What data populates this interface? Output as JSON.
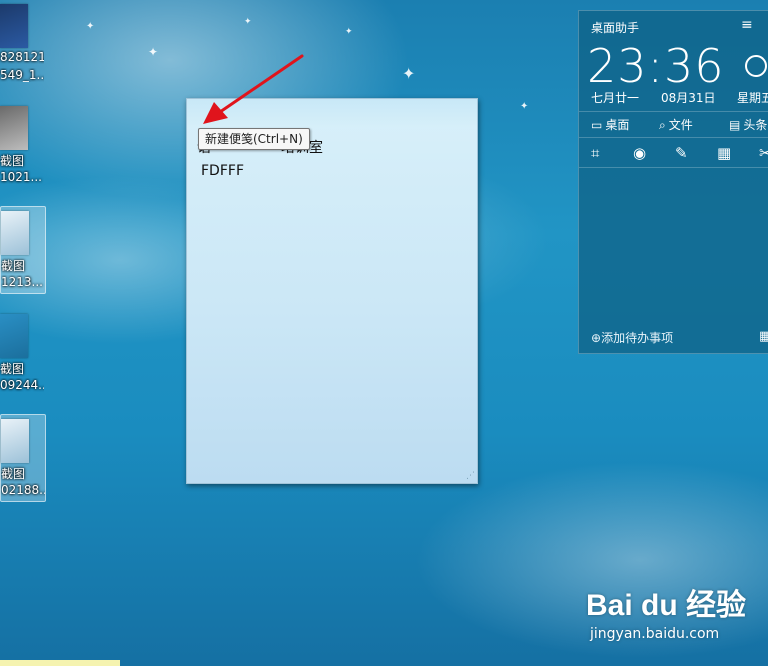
{
  "desktop_icons": [
    {
      "line1": "828121",
      "line2": "549_1...",
      "selected": false
    },
    {
      "line1": "截图",
      "line2": "1021...",
      "selected": false
    },
    {
      "line1": "截图",
      "line2": "1213...",
      "selected": true
    },
    {
      "line1": "截图",
      "line2": "09244...",
      "selected": false
    },
    {
      "line1": "截图",
      "line2": "02188...",
      "selected": true
    }
  ],
  "sticky_note": {
    "line1_visible_start": "语",
    "line1_visible_end": "培训室",
    "line2": "FDFFF"
  },
  "tooltip": {
    "text": "新建便笺(Ctrl+N)"
  },
  "widget": {
    "title": "桌面助手",
    "menu_icon": "≡",
    "time": "23:36",
    "lunar_date": "七月廿一",
    "date": "08月31日",
    "weekday": "星期五",
    "links": [
      {
        "label": "桌面",
        "icon": "monitor-icon"
      },
      {
        "label": "文件",
        "icon": "search-icon"
      },
      {
        "label": "头条",
        "icon": "document-icon"
      }
    ],
    "tools": [
      "crop-icon",
      "eye-icon",
      "note-icon",
      "calculator-icon",
      "scissors-icon"
    ],
    "todo_label": "添加待办事项"
  },
  "watermark": {
    "logo": "Bai du 经验",
    "url": "jingyan.baidu.com"
  },
  "colors": {
    "arrow": "#e0141c",
    "note_bg": "#d8f0fa",
    "widget_bg": "#0e6084"
  }
}
